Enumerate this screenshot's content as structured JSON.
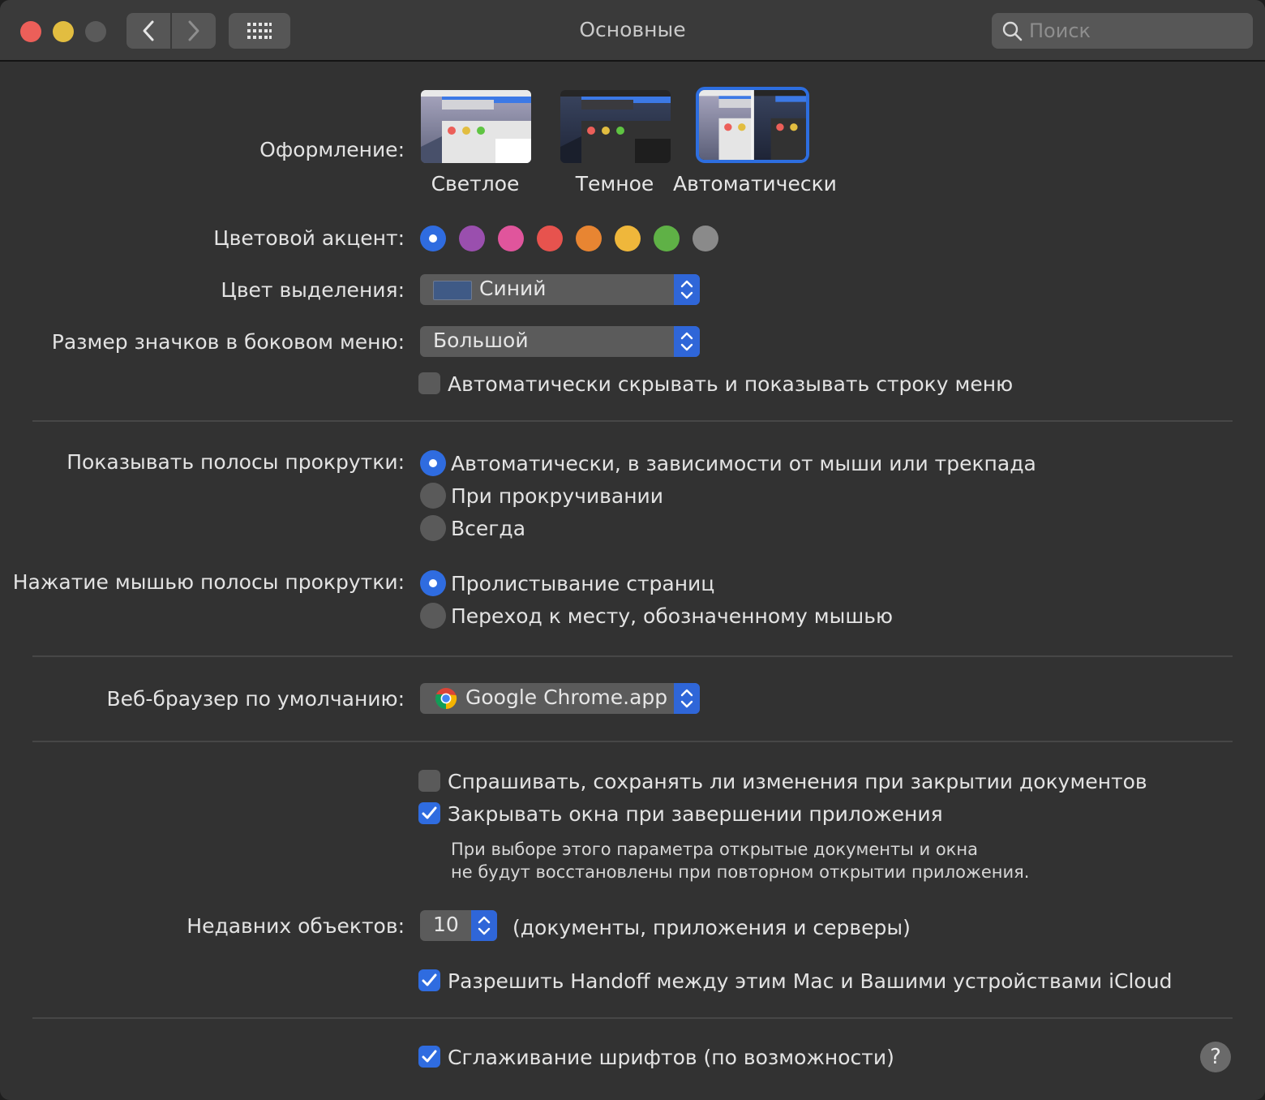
{
  "window": {
    "title": "Основные"
  },
  "search": {
    "placeholder": "Поиск"
  },
  "appearance": {
    "label": "Оформление:",
    "options": [
      {
        "label": "Светлое",
        "selected": false
      },
      {
        "label": "Темное",
        "selected": false
      },
      {
        "label": "Автоматически",
        "selected": true
      }
    ]
  },
  "accent": {
    "label": "Цветовой акцент:",
    "colors": [
      "#2f6ce0",
      "#9a4fae",
      "#e0559c",
      "#e7534e",
      "#e88532",
      "#efb73b",
      "#5fb146",
      "#8a8a8a"
    ],
    "selected_index": 0
  },
  "highlight": {
    "label": "Цвет выделения:",
    "value": "Синий",
    "swatch": "#3f5a86"
  },
  "sidebar_icon_size": {
    "label": "Размер значков в боковом меню:",
    "value": "Большой"
  },
  "menubar_autohide": {
    "label": "Автоматически скрывать и показывать строку меню",
    "checked": false
  },
  "scrollbars": {
    "label": "Показывать полосы прокрутки:",
    "options": [
      {
        "label": "Автоматически, в зависимости от мыши или трекпада",
        "selected": true
      },
      {
        "label": "При прокручивании",
        "selected": false
      },
      {
        "label": "Всегда",
        "selected": false
      }
    ]
  },
  "scroll_click": {
    "label": "Нажатие мышью полосы прокрутки:",
    "options": [
      {
        "label": "Пролистывание страниц",
        "selected": true
      },
      {
        "label": "Переход к месту, обозначенному мышью",
        "selected": false
      }
    ]
  },
  "browser": {
    "label": "Веб-браузер по умолчанию:",
    "value": "Google Chrome.app"
  },
  "ask_save": {
    "label": "Спрашивать, сохранять ли изменения при закрытии документов",
    "checked": false
  },
  "close_windows": {
    "label": "Закрывать окна при завершении приложения",
    "checked": true,
    "note_line1": "При выборе этого параметра открытые документы и окна",
    "note_line2": "не будут восстановлены при повторном открытии приложения."
  },
  "recent": {
    "label": "Недавних объектов:",
    "value": "10",
    "suffix": "(документы, приложения и серверы)"
  },
  "handoff": {
    "label": "Разрешить Handoff между этим Mac и Вашими устройствами iCloud",
    "checked": true
  },
  "font_smoothing": {
    "label": "Сглаживание шрифтов (по возможности)",
    "checked": true
  },
  "help": {
    "label": "?"
  }
}
